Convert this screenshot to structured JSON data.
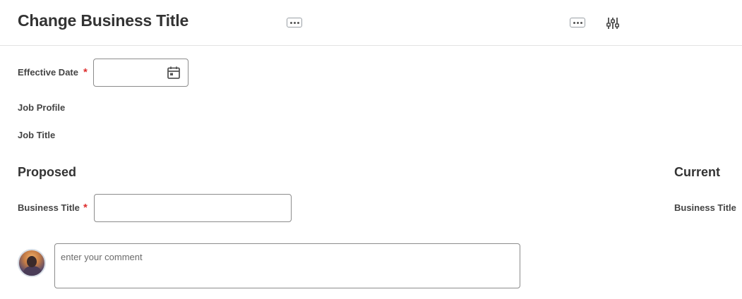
{
  "header": {
    "title": "Change Business Title"
  },
  "form": {
    "effective_date_label": "Effective Date",
    "required_marker": "*",
    "job_profile_label": "Job Profile",
    "job_title_label": "Job Title"
  },
  "proposed": {
    "heading": "Proposed",
    "business_title_label": "Business Title"
  },
  "current": {
    "heading": "Current",
    "business_title_label": "Business Title"
  },
  "comment": {
    "placeholder": "enter your comment"
  },
  "icons": {
    "more_a": "more-horizontal-icon",
    "more_b": "more-horizontal-icon",
    "config": "configure-sliders-icon",
    "calendar": "calendar-icon"
  }
}
